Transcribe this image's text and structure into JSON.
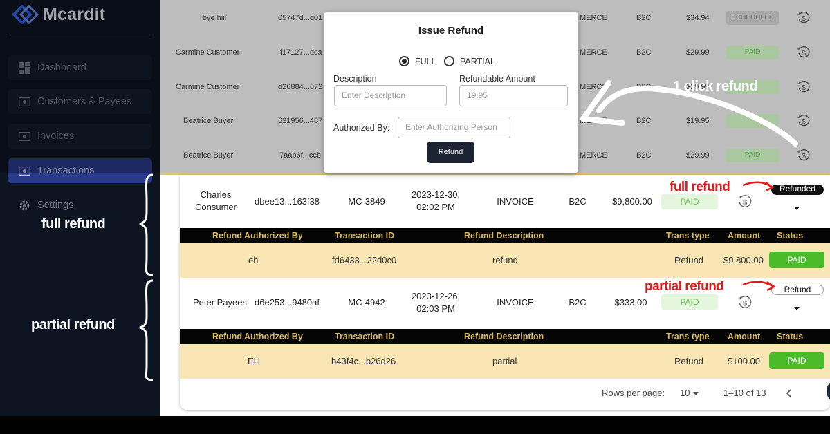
{
  "app": {
    "name": "Mcardit"
  },
  "sidebar": {
    "items": [
      {
        "label": "Dashboard",
        "icon": "dashboard-icon"
      },
      {
        "label": "Customers & Payees",
        "icon": "id-card-icon"
      },
      {
        "label": "Invoices",
        "icon": "invoice-icon"
      },
      {
        "label": "Transactions",
        "icon": "transactions-icon",
        "active": true
      },
      {
        "label": "Settings",
        "icon": "gear-icon"
      }
    ]
  },
  "background_rows": [
    {
      "name": "bye hiii",
      "id": "05747d...d01",
      "type": "MERCE",
      "segment": "B2C",
      "amount": "$34.94",
      "status": "SCHEDULED"
    },
    {
      "name": "Carmine Customer",
      "id": "f17127...dca",
      "type": "MERCE",
      "segment": "B2C",
      "amount": "$29.99",
      "status": "PAID"
    },
    {
      "name": "Carmine Customer",
      "id": "d26884...672",
      "type": "MERCE",
      "segment": "B2C",
      "amount": "$29.99",
      "status": ""
    },
    {
      "name": "Beatrice Buyer",
      "id": "621956...487",
      "type": "MERCE",
      "segment": "B2C",
      "amount": "$19.95",
      "status": ""
    },
    {
      "name": "Beatrice Buyer",
      "id": "7aab6f...ccb",
      "type": "MERCE",
      "segment": "B2C",
      "amount": "$29.99",
      "status": "PAID"
    }
  ],
  "modal": {
    "title": "Issue Refund",
    "option_full": "FULL",
    "option_partial": "PARTIAL",
    "description_label": "Description",
    "description_placeholder": "Enter Description",
    "amount_label": "Refundable Amount",
    "amount_placeholder": "19.95",
    "authorized_label": "Authorized By:",
    "authorized_placeholder": "Enter Authorizing Person",
    "button": "Refund"
  },
  "transactions": [
    {
      "name": "Charles Consumer",
      "id": "dbee13...163f38",
      "ref": "MC-3849",
      "date": "2023-12-30,",
      "time": "02:02 PM",
      "type": "INVOICE",
      "segment": "B2C",
      "amount": "$9,800.00",
      "status": "PAID",
      "refund_tag": "Refunded",
      "refund": {
        "authorized_by": "eh",
        "transaction_id": "fd6433...22d0c0",
        "description": "refund",
        "trans_type": "Refund",
        "amount": "$9,800.00",
        "status": "PAID"
      }
    },
    {
      "name": "Peter Payees",
      "id": "d6e253...9480af",
      "ref": "MC-4942",
      "date": "2023-12-26,",
      "time": "02:03 PM",
      "type": "INVOICE",
      "segment": "B2C",
      "amount": "$333.00",
      "status": "PAID",
      "refund_tag": "Refund",
      "refund": {
        "authorized_by": "EH",
        "transaction_id": "b43f4c...b26d26",
        "description": "partial",
        "trans_type": "Refund",
        "amount": "$100.00",
        "status": "PAID"
      }
    }
  ],
  "refund_headers": {
    "authorized_by": "Refund Authorized By",
    "transaction_id": "Transaction ID",
    "description": "Refund Description",
    "trans_type": "Trans type",
    "amount": "Amount",
    "status": "Status"
  },
  "pagination": {
    "rows_label": "Rows per page:",
    "rows_value": "10",
    "range": "1–10 of 13"
  },
  "annotations": {
    "one_click": "1 click refund",
    "full_left": "full refund",
    "partial_left": "partial refund",
    "full_right": "full refund",
    "partial_right": "partial refund"
  },
  "colors": {
    "accent": "#2a3a8a",
    "paid_green": "#4cbb2b",
    "header_gold": "#d7b85b",
    "refund_row": "#f8e7b4",
    "annotation_red": "#e11b1b"
  }
}
